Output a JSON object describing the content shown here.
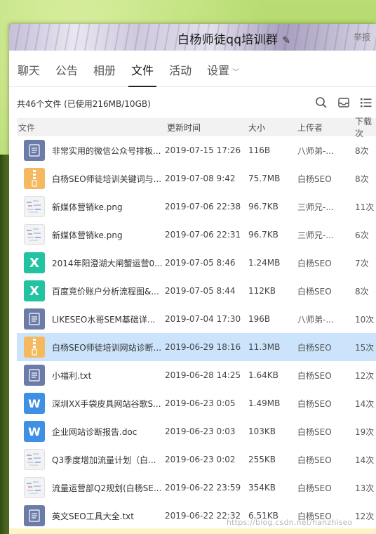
{
  "window": {
    "title": "白杨师徒qq培训群",
    "report": "举报"
  },
  "tabs": [
    {
      "label": "聊天"
    },
    {
      "label": "公告"
    },
    {
      "label": "相册"
    },
    {
      "label": "文件",
      "active": true
    },
    {
      "label": "活动"
    },
    {
      "label": "设置"
    }
  ],
  "toolbar": {
    "summary": "共46个文件 (已使用216MB/10GB)",
    "icons": [
      "search-icon",
      "inbox-icon",
      "list-view-icon"
    ]
  },
  "table": {
    "headers": {
      "name": "文件",
      "time": "更新时间",
      "size": "大小",
      "uploader": "上传者",
      "downloads": "下载次"
    },
    "rows": [
      {
        "icon": "text-file",
        "name": "非常实用的微信公众号排板...",
        "time": "2019-07-15 17:26",
        "size": "116B",
        "uploader": "八师弟-...",
        "downloads": "8次"
      },
      {
        "icon": "zip-file",
        "name": "白杨SEO师徒培训关键词与...",
        "time": "2019-07-08 9:42",
        "size": "75.7MB",
        "uploader": "白杨SEO",
        "downloads": "8次"
      },
      {
        "icon": "image-file",
        "name": "新媒体营销ke.png",
        "time": "2019-07-06 22:38",
        "size": "96.7KB",
        "uploader": "三师兄-...",
        "downloads": "11次"
      },
      {
        "icon": "image-file",
        "name": "新媒体营销ke.png",
        "time": "2019-07-06 22:31",
        "size": "96.7KB",
        "uploader": "三师兄-...",
        "downloads": "6次"
      },
      {
        "icon": "xmind-file",
        "name": "2014年阳澄湖大闸蟹运营0...",
        "time": "2019-07-05 8:46",
        "size": "1.24MB",
        "uploader": "白杨SEO",
        "downloads": "7次"
      },
      {
        "icon": "xmind-file",
        "name": "百度竞价账户分析流程图&...",
        "time": "2019-07-05 8:44",
        "size": "112KB",
        "uploader": "白杨SEO",
        "downloads": "8次"
      },
      {
        "icon": "text-file",
        "name": "LIKESEO水哥SEM基础详...",
        "time": "2019-07-04 17:30",
        "size": "196B",
        "uploader": "八师弟-...",
        "downloads": "10次"
      },
      {
        "icon": "zip-file",
        "name": "白杨SEO师徒培训网站诊断...",
        "time": "2019-06-29 18:16",
        "size": "11.3MB",
        "uploader": "白杨SEO",
        "downloads": "15次",
        "selected": true
      },
      {
        "icon": "text-file",
        "name": "小福利.txt",
        "time": "2019-06-28 14:25",
        "size": "1.64KB",
        "uploader": "白杨SEO",
        "downloads": "12次"
      },
      {
        "icon": "word-file",
        "name": "深圳XX手袋皮具网站谷歌S...",
        "time": "2019-06-23 0:05",
        "size": "1.49MB",
        "uploader": "白杨SEO",
        "downloads": "14次"
      },
      {
        "icon": "word-file",
        "name": "企业网站诊断报告.doc",
        "time": "2019-06-23 0:03",
        "size": "103KB",
        "uploader": "白杨SEO",
        "downloads": "19次"
      },
      {
        "icon": "image-file",
        "name": "Q3季度增加流量计划（白...",
        "time": "2019-06-23 0:02",
        "size": "255KB",
        "uploader": "白杨SEO",
        "downloads": "14次"
      },
      {
        "icon": "image-file",
        "name": "流量运营部Q2规划(白杨SE...",
        "time": "2019-06-22 23:59",
        "size": "354KB",
        "uploader": "白杨SEO",
        "downloads": "13次"
      },
      {
        "icon": "text-file",
        "name": "英文SEO工具大全.txt",
        "time": "2019-06-22 22:32",
        "size": "6.51KB",
        "uploader": "白杨SEO",
        "downloads": "12次"
      }
    ]
  },
  "watermark": "https://blog.csdn.net/hanzhiseo",
  "colors": {
    "selected_row": "#cce4fb",
    "text_file": "#6b7ca8",
    "zip_file": "#f5b95f",
    "xmind_file": "#22c3a0",
    "word_file": "#3f8fe4"
  }
}
